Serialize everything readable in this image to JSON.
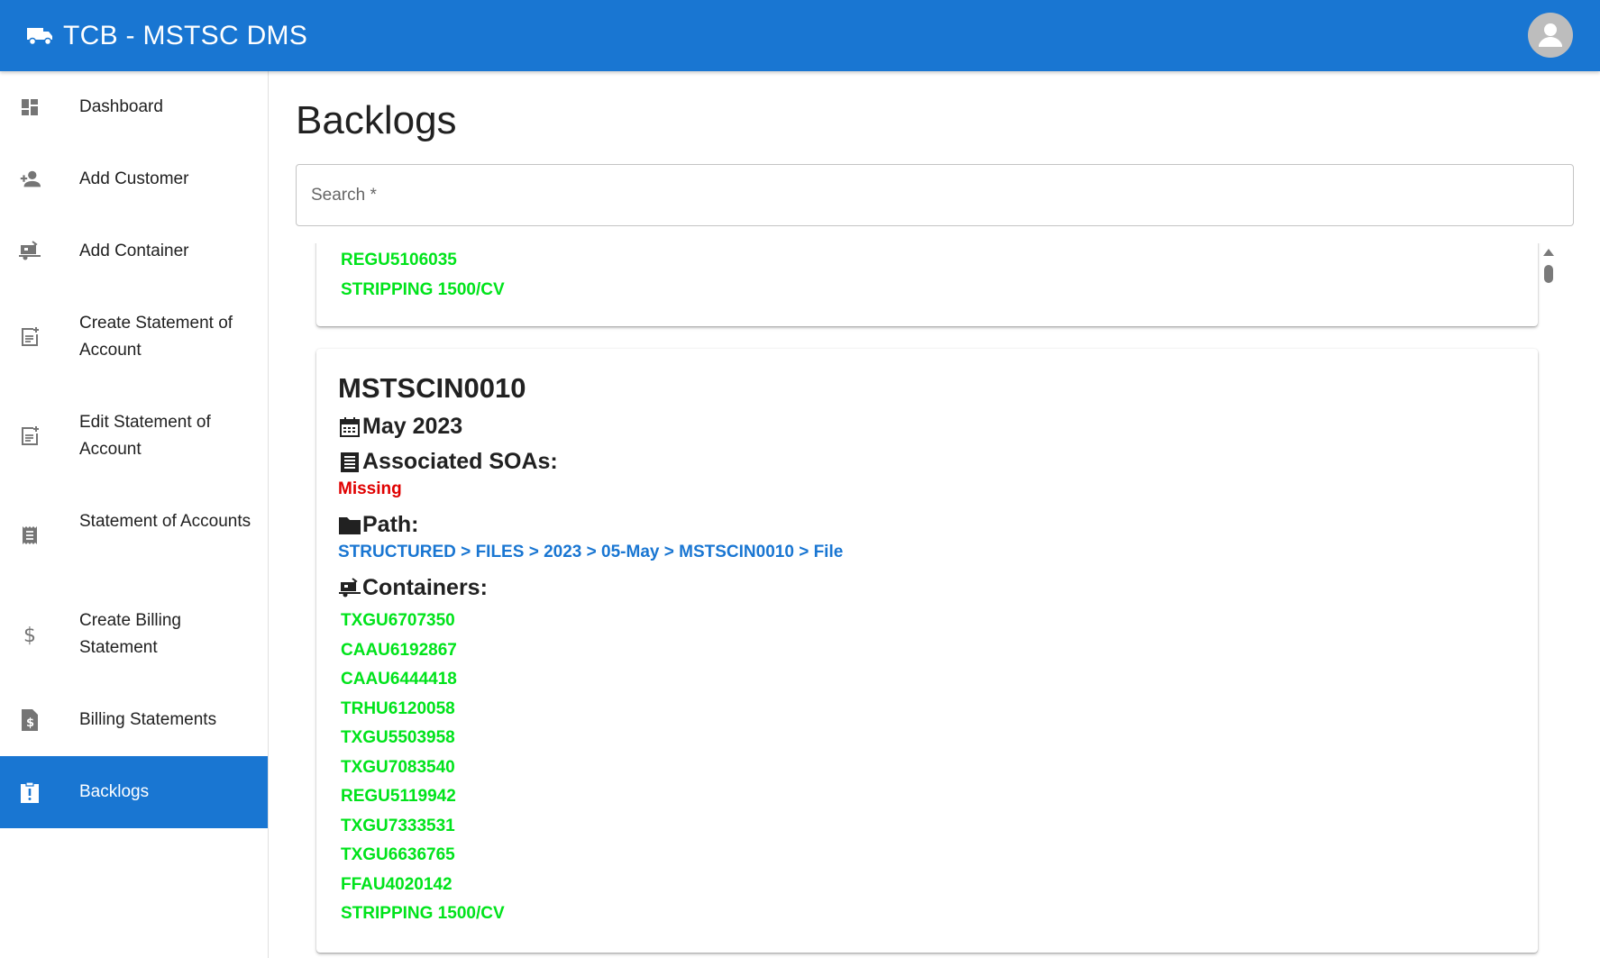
{
  "app": {
    "title": "TCB - MSTSC DMS",
    "logo_icon": "truck-icon",
    "account_icon": "account-circle-icon",
    "accent_color": "#1976d2"
  },
  "sidebar": {
    "items": [
      {
        "label": "Dashboard",
        "icon": "dashboard-icon"
      },
      {
        "label": "Add Customer",
        "icon": "person-add-icon"
      },
      {
        "label": "Add Container",
        "icon": "rv-hookup-icon"
      },
      {
        "label": "Create Statement of Account",
        "icon": "post-add-icon"
      },
      {
        "label": "Edit Statement of Account",
        "icon": "post-add-icon"
      },
      {
        "label": "Statement of Accounts",
        "icon": "receipt-icon"
      },
      {
        "label": "Create Billing Statement",
        "icon": "dollar-icon"
      },
      {
        "label": "Billing Statements",
        "icon": "request-quote-icon"
      },
      {
        "label": "Backlogs",
        "icon": "assignment-late-icon",
        "active": true
      }
    ]
  },
  "main": {
    "title": "Backlogs",
    "search": {
      "placeholder": "Search *",
      "value": ""
    },
    "cards": [
      {
        "containers": [
          "REGU5106035",
          "STRIPPING 1500/CV"
        ]
      },
      {
        "id": "MSTSCIN0010",
        "date": "May 2023",
        "soas_label": "Associated SOAs:",
        "soas_status": "Missing",
        "path_label": "Path:",
        "path": [
          "STRUCTURED",
          "FILES",
          "2023",
          "05-May",
          "MSTSCIN0010",
          "File"
        ],
        "path_separator": ">",
        "containers_label": "Containers:",
        "containers": [
          "TXGU6707350",
          "CAAU6192867",
          "CAAU6444418",
          "TRHU6120058",
          "TXGU5503958",
          "TXGU7083540",
          "REGU5119942",
          "TXGU7333531",
          "TXGU6636765",
          "FFAU4020142",
          "STRIPPING 1500/CV"
        ]
      }
    ]
  },
  "colors": {
    "container_green": "#00e31b",
    "missing_red": "#e00000",
    "path_blue": "#1976d2"
  }
}
